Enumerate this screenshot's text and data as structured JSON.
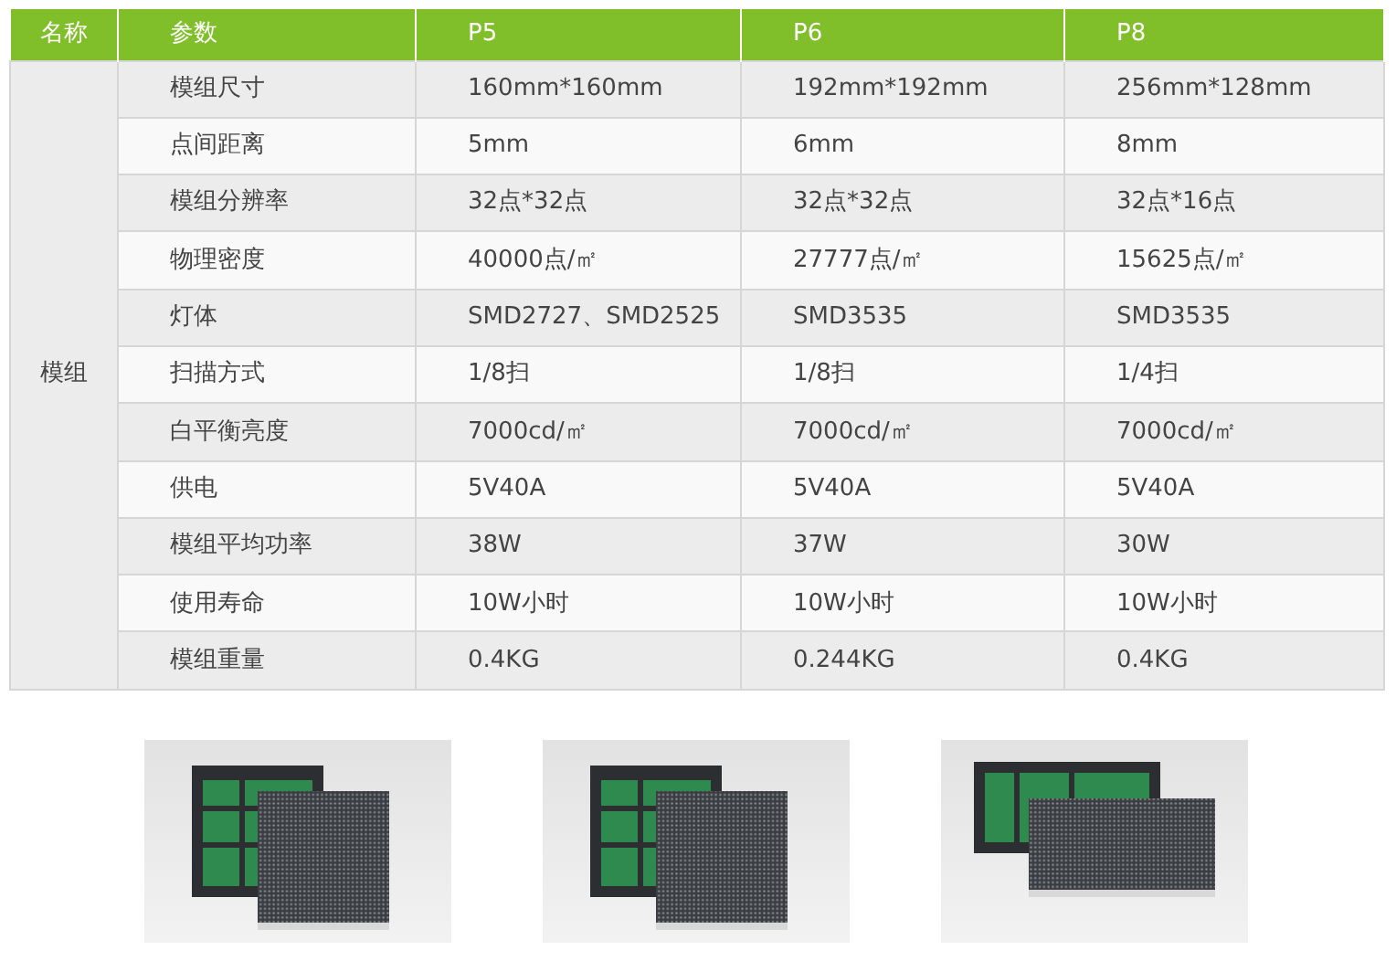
{
  "table": {
    "columns": [
      "名称",
      "参数",
      "P5",
      "P6",
      "P8"
    ],
    "group": "模组",
    "rows": [
      {
        "param": "模组尺寸",
        "values": [
          "160mm*160mm",
          "192mm*192mm",
          "256mm*128mm"
        ]
      },
      {
        "param": "点间距离",
        "values": [
          "5mm",
          "6mm",
          "8mm"
        ]
      },
      {
        "param": "模组分辨率",
        "values": [
          "32点*32点",
          "32点*32点",
          "32点*16点"
        ]
      },
      {
        "param": "物理密度",
        "values": [
          "40000点/㎡",
          "27777点/㎡",
          "15625点/㎡"
        ]
      },
      {
        "param": "灯体",
        "values": [
          "SMD2727、SMD2525",
          "SMD3535",
          "SMD3535"
        ]
      },
      {
        "param": "扫描方式",
        "values": [
          "1/8扫",
          "1/8扫",
          "1/4扫"
        ]
      },
      {
        "param": "白平衡亮度",
        "values": [
          "7000cd/㎡",
          "7000cd/㎡",
          "7000cd/㎡"
        ]
      },
      {
        "param": "供电",
        "values": [
          "5V40A",
          "5V40A",
          "5V40A"
        ]
      },
      {
        "param": "模组平均功率",
        "values": [
          "38W",
          "37W",
          "30W"
        ]
      },
      {
        "param": "使用寿命",
        "values": [
          "10W小时",
          "10W小时",
          "10W小时"
        ]
      },
      {
        "param": "模组重量",
        "values": [
          "0.4KG",
          "0.244KG",
          "0.4KG"
        ]
      }
    ]
  }
}
